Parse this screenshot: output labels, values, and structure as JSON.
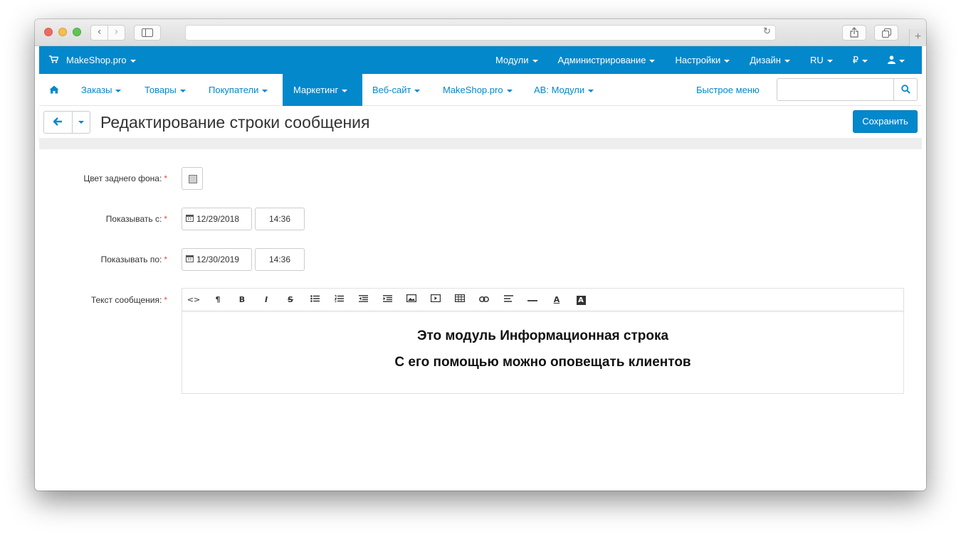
{
  "browser": {
    "back_icon": "chevron-left-icon",
    "forward_icon": "chevron-right-icon",
    "sidebar_icon": "sidebar-icon",
    "reload_icon": "reload-icon",
    "share_icon": "share-icon",
    "tabs_icon": "tabs-icon",
    "new_tab_icon": "plus-icon"
  },
  "topbar": {
    "brand": "MakeShop.pro",
    "items": [
      {
        "label": "Модули"
      },
      {
        "label": "Администрирование"
      },
      {
        "label": "Настройки"
      },
      {
        "label": "Дизайн"
      },
      {
        "label": "RU"
      },
      {
        "label": "₽"
      },
      {
        "label": "👤"
      }
    ]
  },
  "mainnav": {
    "items": [
      {
        "label": "Заказы"
      },
      {
        "label": "Товары"
      },
      {
        "label": "Покупатели"
      },
      {
        "label": "Маркетинг",
        "active": true
      },
      {
        "label": "Веб-сайт"
      },
      {
        "label": "MakeShop.pro"
      },
      {
        "label": "АВ: Модули"
      }
    ],
    "quick_menu": "Быстрое меню",
    "search_value": ""
  },
  "header": {
    "title": "Редактирование строки сообщения",
    "save": "Сохранить"
  },
  "form": {
    "bg_color_label": "Цвет заднего фона:",
    "show_from_label": "Показывать с:",
    "show_from_date": "12/29/2018",
    "show_from_time": "14:36",
    "show_to_label": "Показывать по:",
    "show_to_date": "12/30/2019",
    "show_to_time": "14:36",
    "message_label": "Текст сообщения:",
    "required_mark": "*"
  },
  "editor": {
    "toolbar": {
      "code": "<>",
      "paragraph": "¶",
      "bold": "B",
      "italic": "I",
      "strike": "S",
      "link": "🔗",
      "font_color": "A",
      "bg_color": "A"
    },
    "lines": [
      "Это модуль Информационная строка",
      "С его помощью можно оповещать клиентов"
    ]
  },
  "colors": {
    "accent": "#0388cc",
    "required": "#e74c3c"
  }
}
